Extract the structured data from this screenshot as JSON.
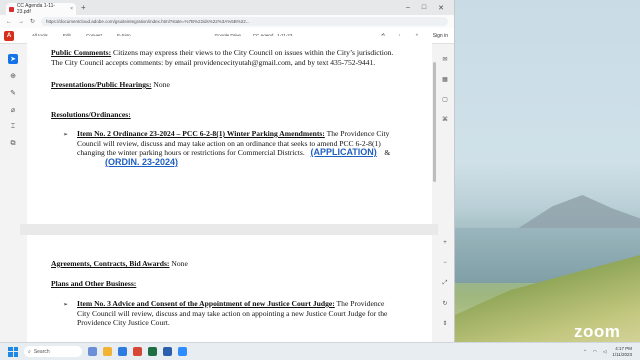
{
  "browser": {
    "tab_title": "CC Agenda 1-11-23.pdf",
    "tab_close": "×",
    "new_tab": "+",
    "window_controls": [
      "–",
      "□",
      "✕"
    ],
    "url": "https://documentcloud.adobe.com/gsuiteintegration/index.html?state=%7B%22ids%22%3A%5B%22...",
    "nav": [
      "←",
      "→",
      "↻"
    ]
  },
  "acrobat": {
    "logo": "A",
    "menu": [
      "All tools",
      "Edit",
      "Convert",
      "E-Sign"
    ],
    "source": "Google Drive",
    "doc_name": "CC Agend...1-11-23",
    "signin": "Sign in"
  },
  "document": {
    "public_comments_heading": "Public Comments:",
    "public_comments_text_1": "  Citizens may express their views to the City Council on issues within the City’s jurisdiction.",
    "public_comments_text_2": "The City  Council accepts comments: by email providencecityutah@gmail.com, and by text 435-752-9441.",
    "presentations_heading": "Presentations/Public Hearings:",
    "presentations_value": " None",
    "resolutions_heading": "Resolutions/Ordinances:",
    "item2_title": "Item No.  2   Ordinance 23-2024 – PCC 6-2-8(1) Winter Parking Amendments:",
    "item2_text_1": " The Providence City",
    "item2_text_2": "Council will review, discuss and may take action on an ordinance that seeks to amend PCC 6-2-8(1)",
    "item2_text_3": "changing the winter parking hours or restrictions for Commercial Districts.",
    "item2_link_1": "(APPLICATION)",
    "item2_amp": "&",
    "item2_link_2": "(ORDIN. 23-2024)",
    "agreements_heading": "Agreements, Contracts, Bid Awards:",
    "agreements_value": "  None",
    "plans_heading": "Plans and Other Business:",
    "item3_title": "Item No.  3    Advice and Consent of the Appointment of new Justice Court Judge:",
    "item3_text_1": " The Providence",
    "item3_text_2": "City Council will review, discuss and may take action on appointing a new Justice Court Judge for the",
    "item3_text_3": "Providence City Justice Court.",
    "bullet": "➢"
  },
  "desktop": {
    "zoom_logo": "zoom"
  },
  "taskbar": {
    "search_placeholder": "Search",
    "time": "4:17 PM",
    "date": "1/11/2023"
  }
}
